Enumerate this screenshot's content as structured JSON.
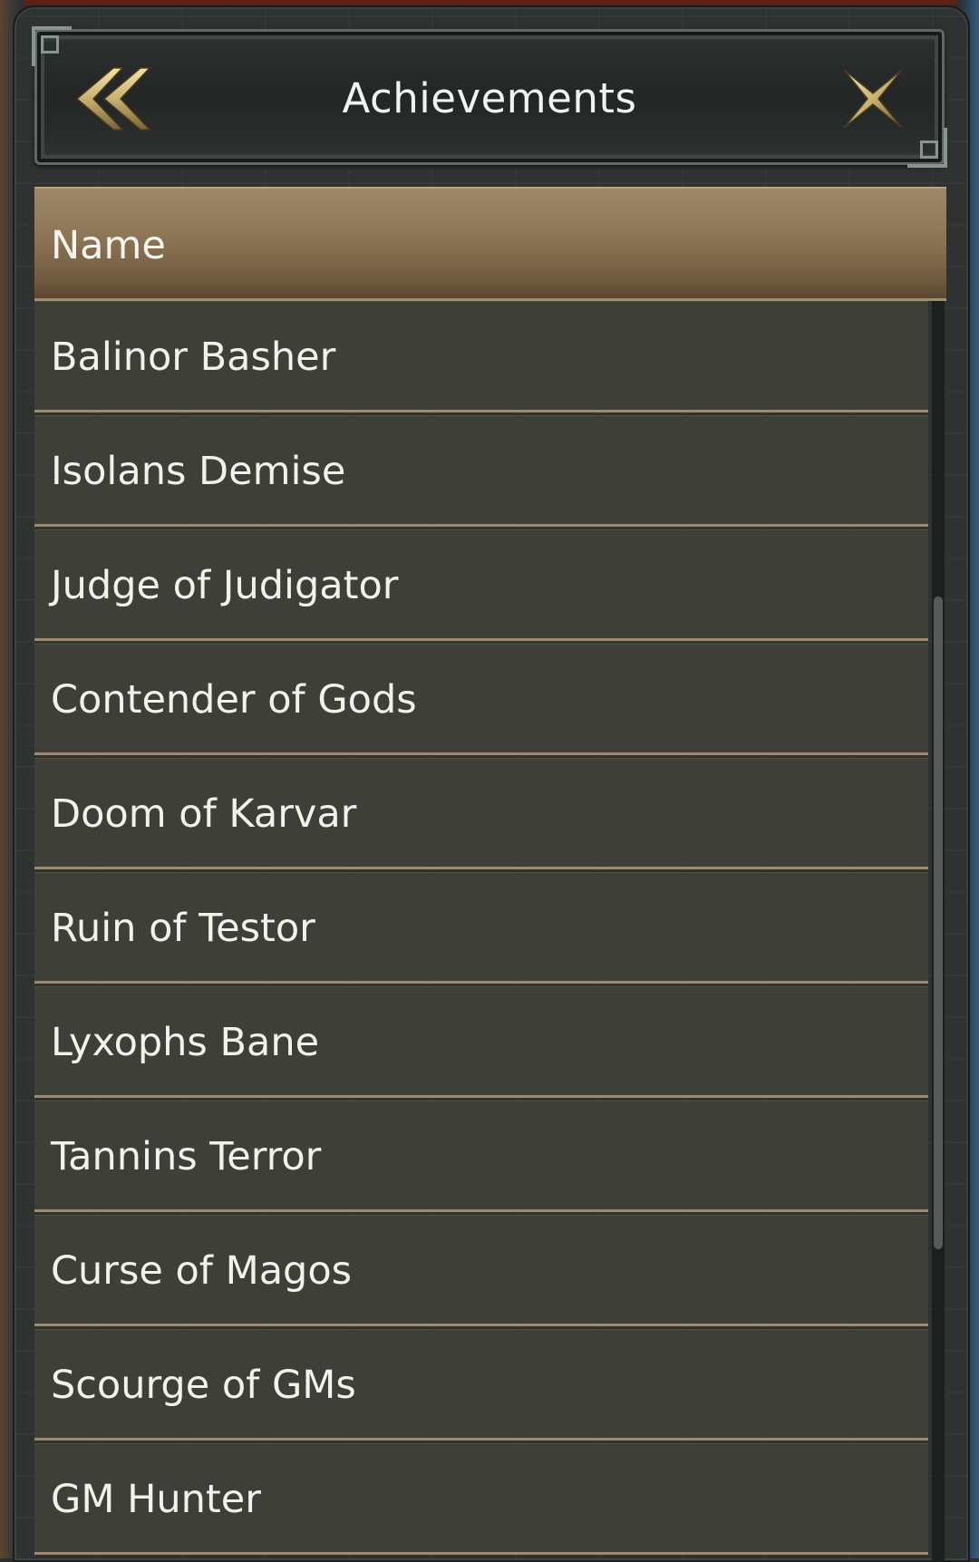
{
  "window": {
    "title": "Achievements",
    "back_icon": "double-chevron-left-icon",
    "close_icon": "x-close-icon"
  },
  "table": {
    "header": "Name",
    "rows": [
      "Balinor Basher",
      "Isolans Demise",
      "Judge of Judigator",
      "Contender of Gods",
      "Doom of Karvar",
      "Ruin of Testor",
      "Lyxophs Bane",
      "Tannins Terror",
      "Curse of Magos",
      "Scourge of GMs",
      "GM Hunter"
    ]
  },
  "colors": {
    "header_gold": "#8c7554",
    "row_bg": "#42423a",
    "ornament_gold": "#c9b270",
    "text": "#f3f1ec"
  }
}
